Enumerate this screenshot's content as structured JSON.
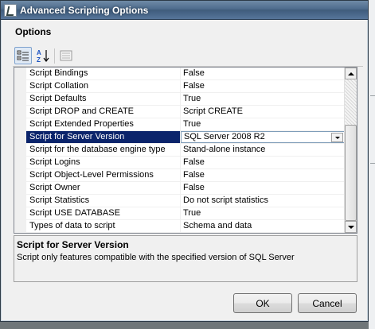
{
  "window": {
    "title": "Advanced Scripting Options"
  },
  "section_label": "Options",
  "toolbar": {
    "categorized": "categorized-view-icon",
    "alphabetical": "alphabetical-sort-icon",
    "property_pages": "property-pages-icon"
  },
  "properties": [
    {
      "name": "Script Bindings",
      "value": "False",
      "selected": false
    },
    {
      "name": "Script Collation",
      "value": "False",
      "selected": false
    },
    {
      "name": "Script Defaults",
      "value": "True",
      "selected": false
    },
    {
      "name": "Script DROP and CREATE",
      "value": "Script CREATE",
      "selected": false
    },
    {
      "name": "Script Extended Properties",
      "value": "True",
      "selected": false
    },
    {
      "name": "Script for Server Version",
      "value": "SQL Server 2008 R2",
      "selected": true
    },
    {
      "name": "Script for the database engine type",
      "value": "Stand-alone instance",
      "selected": false
    },
    {
      "name": "Script Logins",
      "value": "False",
      "selected": false
    },
    {
      "name": "Script Object-Level Permissions",
      "value": "False",
      "selected": false
    },
    {
      "name": "Script Owner",
      "value": "False",
      "selected": false
    },
    {
      "name": "Script Statistics",
      "value": "Do not script statistics",
      "selected": false
    },
    {
      "name": "Script USE DATABASE",
      "value": "True",
      "selected": false
    },
    {
      "name": "Types of data to script",
      "value": "Schema and data",
      "selected": false
    }
  ],
  "description": {
    "title": "Script for Server Version",
    "text": "Script only features compatible with the specified version of SQL Server"
  },
  "buttons": {
    "ok": "OK",
    "cancel": "Cancel"
  },
  "colors": {
    "selection": "#0b246b",
    "titlebar": "#4e6c8d"
  }
}
